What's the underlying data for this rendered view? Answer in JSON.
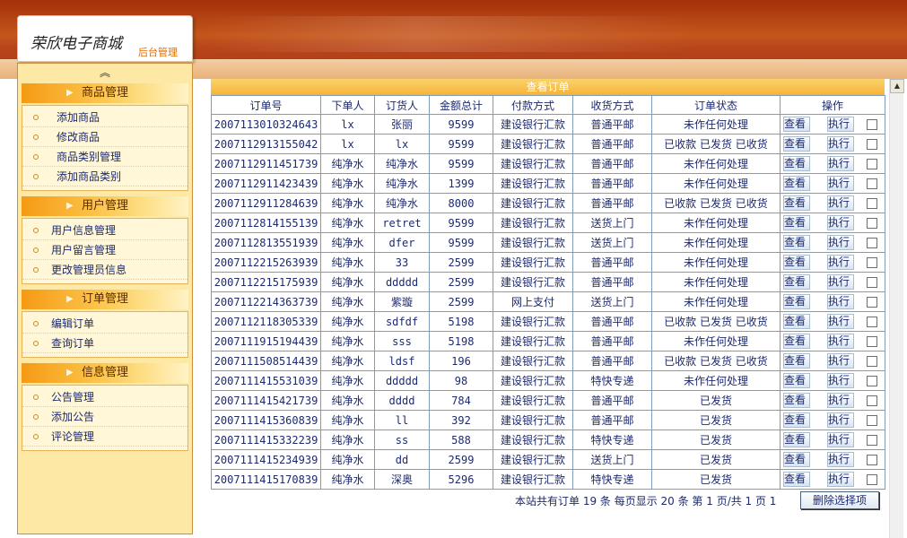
{
  "header": {
    "title": "荣欣电子商城",
    "subtitle": "后台管理"
  },
  "sidebar": {
    "collapse_glyph": "≈",
    "groups": [
      {
        "title": "商品管理",
        "items": [
          "添加商品",
          "修改商品",
          "商品类别管理",
          "添加商品类别"
        ]
      },
      {
        "title": "用户管理",
        "items": [
          "用户信息管理",
          "用户留言管理",
          "更改管理员信息"
        ]
      },
      {
        "title": "订单管理",
        "items": [
          "编辑订单",
          "查询订单"
        ]
      },
      {
        "title": "信息管理",
        "items": [
          "公告管理",
          "添加公告",
          "评论管理"
        ]
      }
    ]
  },
  "orders": {
    "title": "查看订单",
    "headers": [
      "订单号",
      "下单人",
      "订货人",
      "金额总计",
      "付款方式",
      "收货方式",
      "订单状态",
      "操作"
    ],
    "view_label": "查看",
    "exec_label": "执行",
    "rows": [
      [
        "2007113010324643",
        "lx",
        "张丽",
        "9599",
        "建设银行汇款",
        "普通平邮",
        "未作任何处理"
      ],
      [
        "2007112913155042",
        "lx",
        "lx",
        "9599",
        "建设银行汇款",
        "普通平邮",
        "已收款 已发货 已收货"
      ],
      [
        "2007112911451739",
        "纯净水",
        "纯净水",
        "9599",
        "建设银行汇款",
        "普通平邮",
        "未作任何处理"
      ],
      [
        "2007112911423439",
        "纯净水",
        "纯净水",
        "1399",
        "建设银行汇款",
        "普通平邮",
        "未作任何处理"
      ],
      [
        "2007112911284639",
        "纯净水",
        "纯净水",
        "8000",
        "建设银行汇款",
        "普通平邮",
        "已收款 已发货 已收货"
      ],
      [
        "2007112814155139",
        "纯净水",
        "retret",
        "9599",
        "建设银行汇款",
        "送货上门",
        "未作任何处理"
      ],
      [
        "2007112813551939",
        "纯净水",
        "dfer",
        "9599",
        "建设银行汇款",
        "送货上门",
        "未作任何处理"
      ],
      [
        "2007112215263939",
        "纯净水",
        "33",
        "2599",
        "建设银行汇款",
        "普通平邮",
        "未作任何处理"
      ],
      [
        "2007112215175939",
        "纯净水",
        "ddddd",
        "2599",
        "建设银行汇款",
        "普通平邮",
        "未作任何处理"
      ],
      [
        "2007112214363739",
        "纯净水",
        "紫璇",
        "2599",
        "网上支付",
        "送货上门",
        "未作任何处理"
      ],
      [
        "2007112118305339",
        "纯净水",
        "sdfdf",
        "5198",
        "建设银行汇款",
        "普通平邮",
        "已收款 已发货 已收货"
      ],
      [
        "2007111915194439",
        "纯净水",
        "sss",
        "5198",
        "建设银行汇款",
        "普通平邮",
        "未作任何处理"
      ],
      [
        "2007111508514439",
        "纯净水",
        "ldsf",
        "196",
        "建设银行汇款",
        "普通平邮",
        "已收款 已发货 已收货"
      ],
      [
        "2007111415531039",
        "纯净水",
        "ddddd",
        "98",
        "建设银行汇款",
        "特快专递",
        "未作任何处理"
      ],
      [
        "2007111415421739",
        "纯净水",
        "dddd",
        "784",
        "建设银行汇款",
        "普通平邮",
        "已发货"
      ],
      [
        "2007111415360839",
        "纯净水",
        "ll",
        "392",
        "建设银行汇款",
        "普通平邮",
        "已发货"
      ],
      [
        "2007111415332239",
        "纯净水",
        "ss",
        "588",
        "建设银行汇款",
        "特快专递",
        "已发货"
      ],
      [
        "2007111415234939",
        "纯净水",
        "dd",
        "2599",
        "建设银行汇款",
        "送货上门",
        "已发货"
      ],
      [
        "2007111415170839",
        "纯净水",
        "深奥",
        "5296",
        "建设银行汇款",
        "特快专递",
        "已发货"
      ]
    ]
  },
  "footer": {
    "summary": "本站共有订单 19  条 每页显示 20 条 第 1 页/共 1 页 1",
    "delete_label": "删除选择项"
  }
}
